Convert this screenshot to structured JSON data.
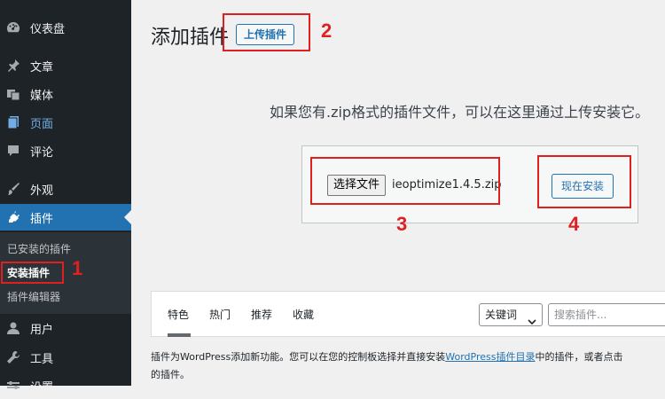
{
  "sidebar": {
    "items": [
      {
        "label": "仪表盘",
        "icon": "dashboard-icon"
      },
      {
        "label": "文章",
        "icon": "pin-icon"
      },
      {
        "label": "媒体",
        "icon": "media-icon"
      },
      {
        "label": "页面",
        "icon": "page-icon"
      },
      {
        "label": "评论",
        "icon": "comment-icon"
      },
      {
        "label": "外观",
        "icon": "brush-icon"
      },
      {
        "label": "插件",
        "icon": "plugin-icon"
      },
      {
        "label": "用户",
        "icon": "user-icon"
      },
      {
        "label": "工具",
        "icon": "wrench-icon"
      },
      {
        "label": "设置",
        "icon": "settings-icon"
      }
    ],
    "submenu": [
      "已安装的插件",
      "安装插件",
      "插件编辑器"
    ]
  },
  "header": {
    "title": "添加插件",
    "upload_label": "上传插件"
  },
  "upload": {
    "help": "如果您有.zip格式的插件文件，可以在这里通过上传安装它。",
    "choose_file": "选择文件",
    "file_name": "ieoptimize1.4.5.zip",
    "install_now": "现在安装"
  },
  "filter": {
    "tabs": [
      "特色",
      "热门",
      "推荐",
      "收藏"
    ],
    "search_type": "关键词",
    "search_placeholder": "搜索插件..."
  },
  "description": {
    "before": "插件为WordPress添加新功能。您可以在您的控制板选择并直接安装",
    "link": "WordPress插件目录",
    "after": "中的插件，或者点击",
    "line2": "的插件。"
  },
  "annotations": [
    "1",
    "2",
    "3",
    "4"
  ],
  "colors": {
    "accent": "#2271b1",
    "sidebar": "#1d2327",
    "annotation": "#e02020"
  }
}
